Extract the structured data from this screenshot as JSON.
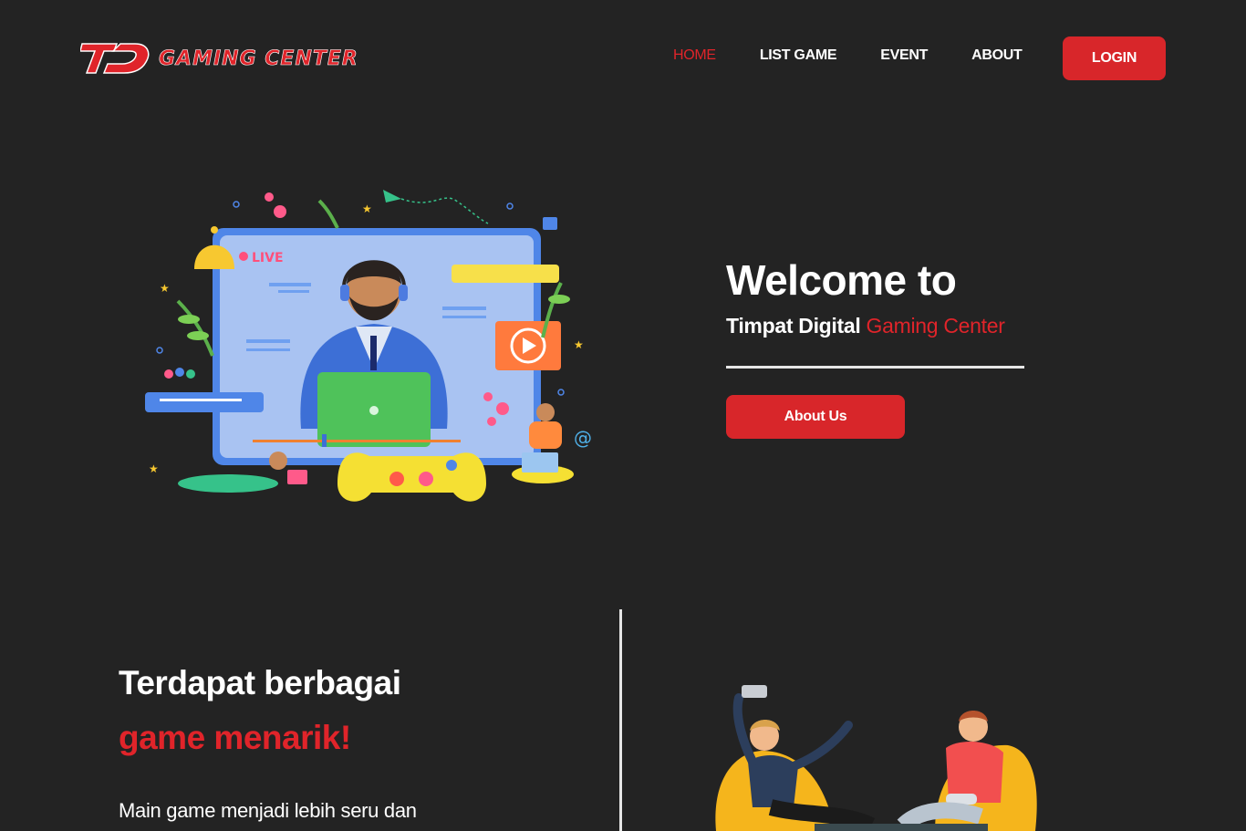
{
  "brand": {
    "name": "GAMING CENTER",
    "logo_mark": "TD",
    "accent": "#e0242a"
  },
  "nav": {
    "items": [
      {
        "label": "HOME",
        "active": true
      },
      {
        "label": "LIST GAME",
        "active": false
      },
      {
        "label": "EVENT",
        "active": false
      },
      {
        "label": "ABOUT",
        "active": false
      }
    ],
    "login_label": "LOGIN"
  },
  "hero": {
    "title": "Welcome to",
    "subtitle_plain": "Timpat Digital",
    "subtitle_accent": "Gaming Center",
    "button_label": "About Us",
    "live_badge": "LIVE",
    "illustration": "live-streamer-illustration"
  },
  "features": {
    "title_line1": "Terdapat berbagai",
    "title_line2": "game menarik!",
    "description": "Main game menjadi lebih seru dan",
    "illustration": "friends-gaming-illustration"
  }
}
